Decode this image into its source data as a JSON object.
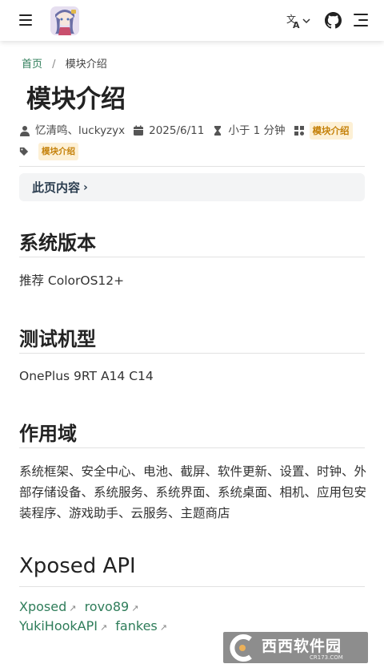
{
  "navbar": {
    "menu_icon": "hamburger-menu-icon",
    "logo_icon": "anime-avatar-logo",
    "lang_icon": "translate-icon",
    "github_icon": "github-icon",
    "toc_icon": "toc-outline-icon"
  },
  "breadcrumb": {
    "home": "首页",
    "separator": "/",
    "current": "模块介绍"
  },
  "page": {
    "title": "模块介绍",
    "authors": "忆清鸣、luckyzyx",
    "date": "2025/6/11",
    "read_time": "小于 1 分钟",
    "category": "模块介绍",
    "tag": "模块介绍"
  },
  "toc": {
    "label": "此页内容",
    "chevron": "›"
  },
  "sections": {
    "version": {
      "title": "系统版本",
      "text": "推荐 ColorOS12+"
    },
    "devices": {
      "title": "测试机型",
      "text": "OnePlus 9RT A14 C14"
    },
    "scope": {
      "title": "作用域",
      "text": "系统框架、安全中心、电池、截屏、软件更新、设置、时钟、外部存储设备、系统服务、系统界面、系统桌面、相机、应用包安装程序、游戏助手、云服务、主题商店"
    },
    "api": {
      "title": "Xposed API",
      "links": [
        {
          "label": "Xposed",
          "arrow": "↗"
        },
        {
          "label": "rovo89",
          "arrow": "↗"
        },
        {
          "label": "YukiHookAPI",
          "arrow": "↗"
        },
        {
          "label": "fankes",
          "arrow": "↗"
        }
      ]
    }
  },
  "watermark": {
    "text": "西西软件园",
    "subtext": "CR173.COM"
  },
  "colors": {
    "link": "#2f7d5a",
    "tag_bg": "#fdf0d5",
    "tag_text": "#c5810a"
  }
}
